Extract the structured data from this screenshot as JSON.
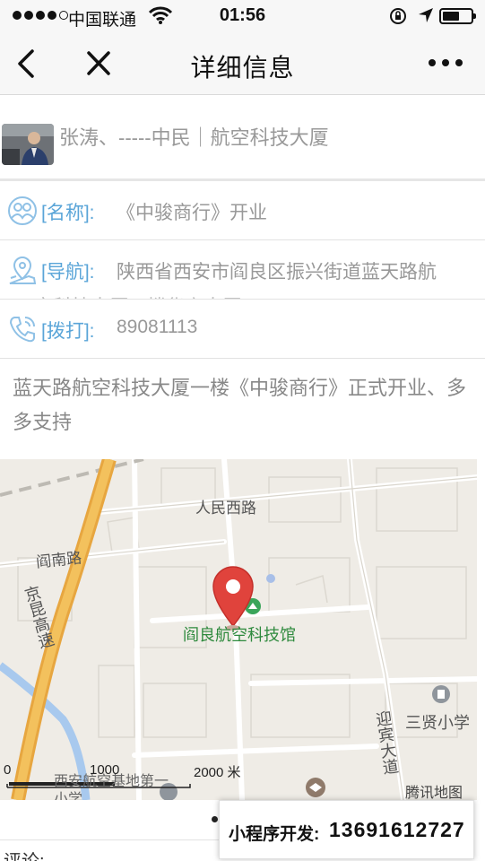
{
  "status_bar": {
    "carrier": "中国联通",
    "time": "01:56"
  },
  "nav": {
    "title": "详细信息"
  },
  "post": {
    "author_line": "张涛、-----中民｜航空科技大厦"
  },
  "info": {
    "name_label": "[名称]:",
    "name_value": "《中骏商行》开业",
    "nav_label": "[导航]:",
    "nav_value": "陕西省西安市阎良区振兴街道蓝天路航",
    "nav_value_cut": "空科技大厦一楼华宇大厦",
    "call_label": "[拨打]:",
    "call_value": "89081113"
  },
  "description": "蓝天路航空科技大厦一楼《中骏商行》正式开业、多多支持",
  "map": {
    "marker_label": "阎良航空科技馆",
    "labels": {
      "road_north": "人民西路",
      "road_west": "阎南路",
      "highway": "京昆高速",
      "road_east": "迎宾大道",
      "school": "三贤小学",
      "bottom_school": "西安航空基地第一小学",
      "brand": "腾讯地图"
    },
    "scale": {
      "zero": "0",
      "mid": "1000",
      "end": "2000 米"
    }
  },
  "promo": {
    "label": "小程序开发:",
    "phone": "13691612727"
  },
  "comment_label": "评论:"
}
